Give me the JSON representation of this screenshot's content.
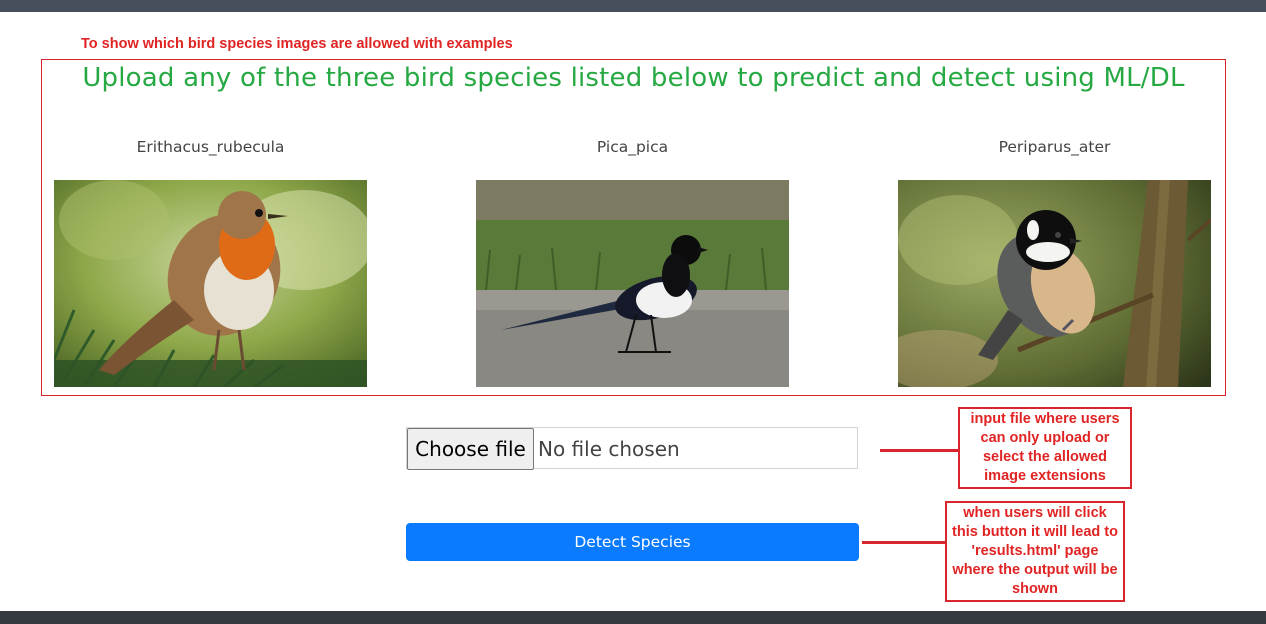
{
  "annotations": {
    "heading": "To show which bird species images are allowed with examples",
    "file_input_note": "input file where users can only upload or select the allowed image extensions",
    "button_note": "when users will click this button it will lead to 'results.html' page where the output will be shown"
  },
  "examples": {
    "title": "Upload any of the three bird species listed below to predict and detect using ML/DL",
    "birds": [
      {
        "name": "Erithacus_rubecula"
      },
      {
        "name": "Pica_pica"
      },
      {
        "name": "Periparus_ater"
      }
    ]
  },
  "upload": {
    "choose_label": "Choose file",
    "status": "No file chosen",
    "submit_label": "Detect Species"
  },
  "colors": {
    "annotation_red": "#e02424",
    "title_green": "#26a943",
    "primary_button": "#0a7bff"
  }
}
